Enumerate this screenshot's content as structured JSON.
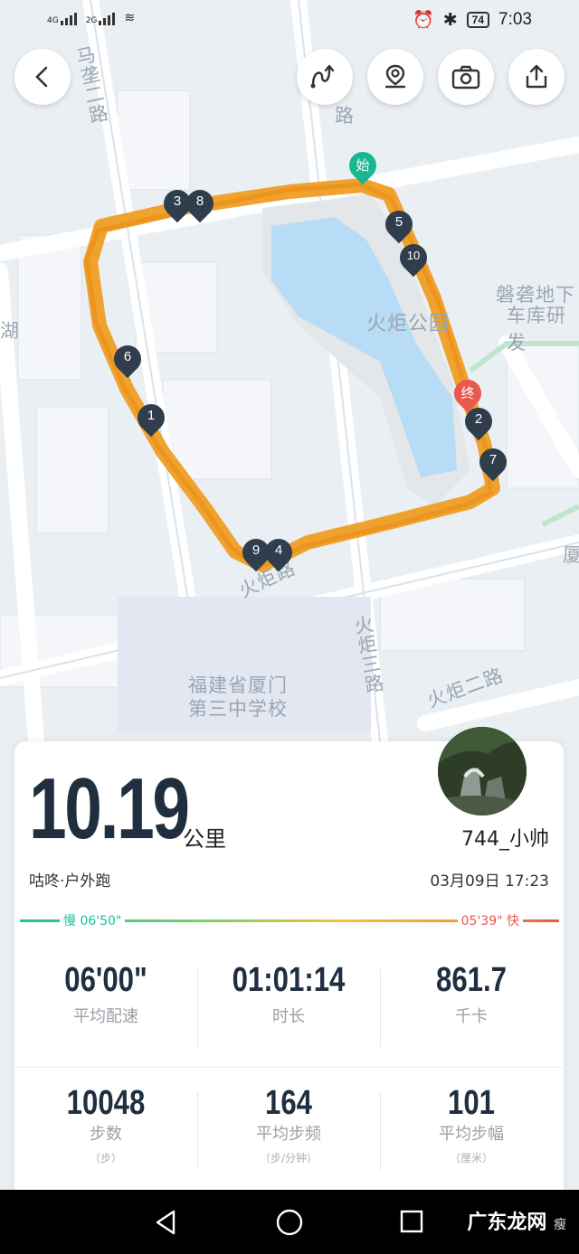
{
  "status_bar": {
    "net1": "4G",
    "net2": "2G",
    "battery": "74",
    "time": "7:03"
  },
  "map": {
    "labels": [
      "马垄二路",
      "路",
      "火炬公园",
      "磐砻地下",
      "车库研发",
      "湖",
      "厦",
      "火炬路",
      "火炬三路",
      "火炬二路",
      "福建省厦门",
      "第三中学校"
    ],
    "start_label": "始",
    "end_label": "终",
    "km_markers": [
      "1",
      "2",
      "3",
      "4",
      "5",
      "6",
      "7",
      "8",
      "9",
      "10"
    ],
    "route_color": "#f0a22e"
  },
  "toolbar": {
    "back": "back-icon",
    "route": "route-icon",
    "location": "location-pin-icon",
    "camera": "camera-icon",
    "share": "share-icon"
  },
  "summary": {
    "distance": "10.19",
    "unit": "公里",
    "username": "744_小帅",
    "activity": "咕咚·户外跑",
    "datetime": "03月09日 17:23",
    "pace_slow": "慢 06'50\"",
    "pace_fast": "05'39\" 快"
  },
  "stats_row1": [
    {
      "value": "06'00\"",
      "label": "平均配速"
    },
    {
      "value": "01:01:14",
      "label": "时长"
    },
    {
      "value": "861.7",
      "label": "千卡"
    }
  ],
  "stats_row2": [
    {
      "value": "10048",
      "label": "步数",
      "unit": "（步）"
    },
    {
      "value": "164",
      "label": "平均步频",
      "unit": "（步/分钟）"
    },
    {
      "value": "101",
      "label": "平均步幅",
      "unit": "（厘米）"
    }
  ],
  "watermark": {
    "brand": "广东龙网",
    "sub": "瘦"
  },
  "colors": {
    "accent_dark": "#1f2f3f",
    "pace_slow": "#1fbf9c",
    "pace_fast": "#e8594f"
  }
}
